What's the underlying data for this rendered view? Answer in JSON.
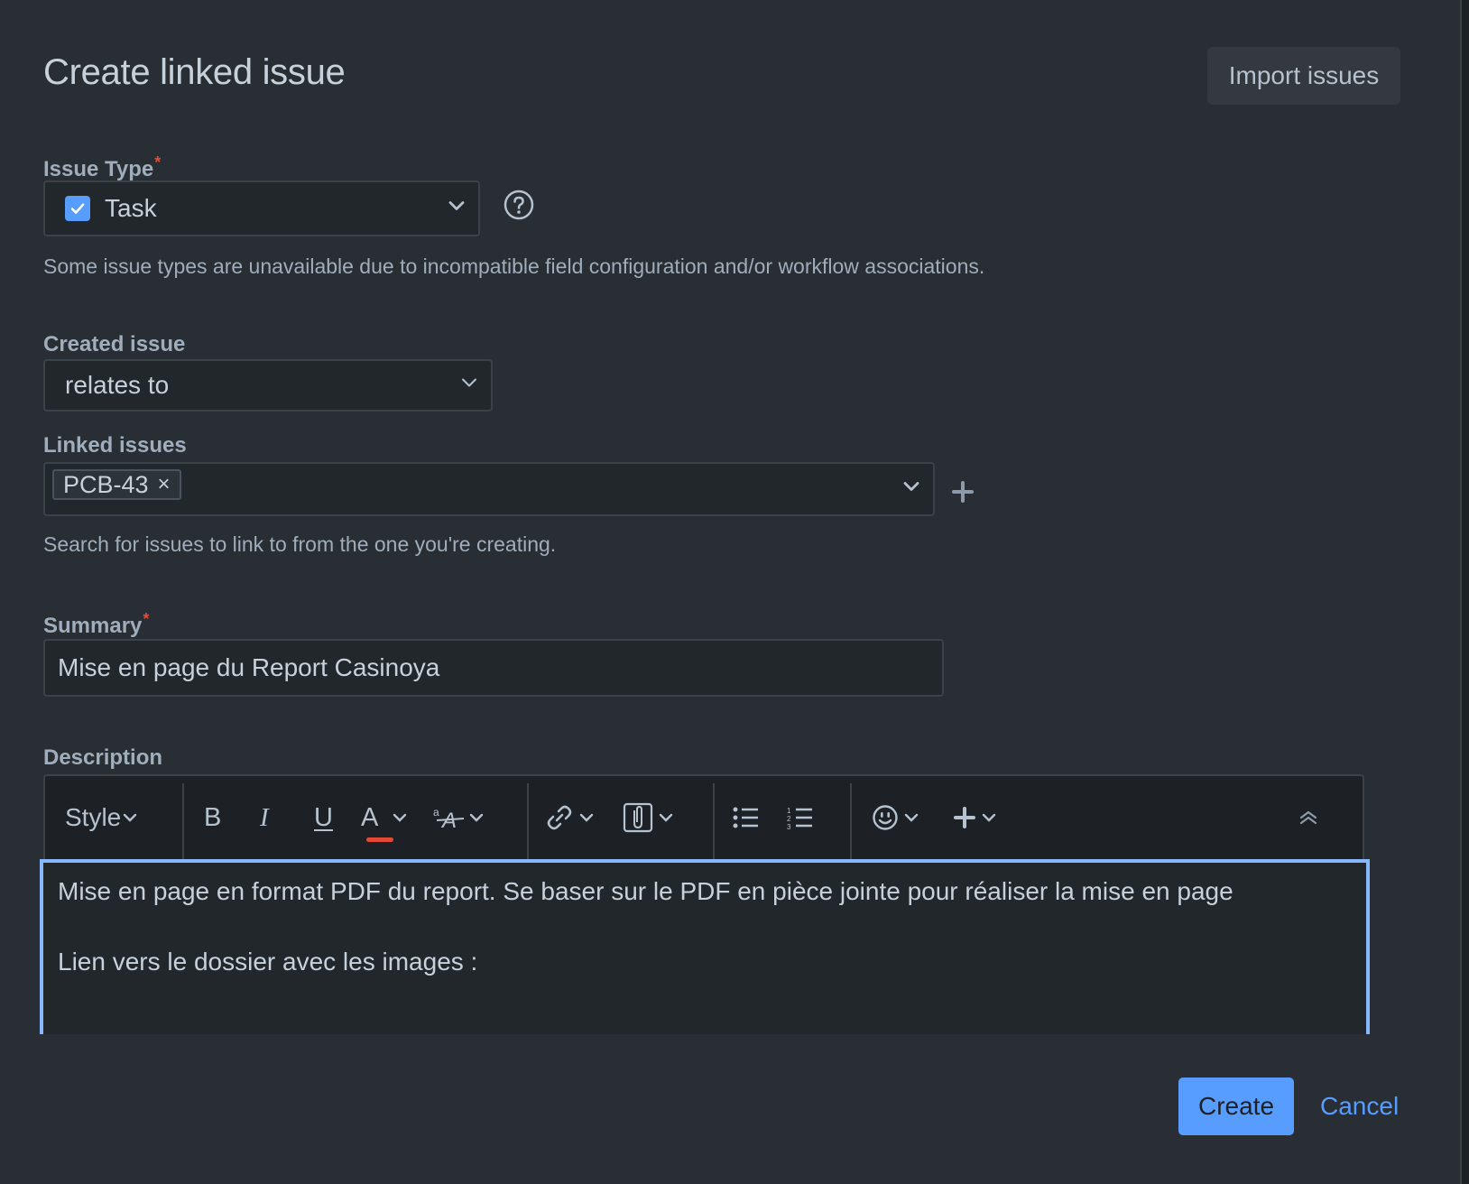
{
  "dialog": {
    "title": "Create linked issue",
    "import_label": "Import issues"
  },
  "issue_type": {
    "label": "Issue Type",
    "required_mark": "*",
    "value": "Task",
    "help": "Some issue types are unavailable due to incompatible field configuration and/or workflow associations."
  },
  "created_issue": {
    "label": "Created issue",
    "value": "relates to"
  },
  "linked_issues": {
    "label": "Linked issues",
    "tag": "PCB-43",
    "tag_remove": "×",
    "help": "Search for issues to link to from the one you're creating."
  },
  "summary": {
    "label": "Summary",
    "required_mark": "*",
    "value": "Mise en page du Report Casinoya"
  },
  "description": {
    "label": "Description",
    "toolbar": {
      "style_label": "Style",
      "bold": "B",
      "italic": "I",
      "underline": "U",
      "text_color": "A"
    },
    "paragraphs": [
      "Mise en page en format PDF du report. Se baser sur le PDF en pièce jointe pour réaliser la mise en page",
      "Lien vers le dossier avec les images :"
    ]
  },
  "footer": {
    "create_label": "Create",
    "cancel_label": "Cancel"
  },
  "colors": {
    "accent": "#579dff",
    "required": "#e34935",
    "focus": "#85b8ff"
  }
}
